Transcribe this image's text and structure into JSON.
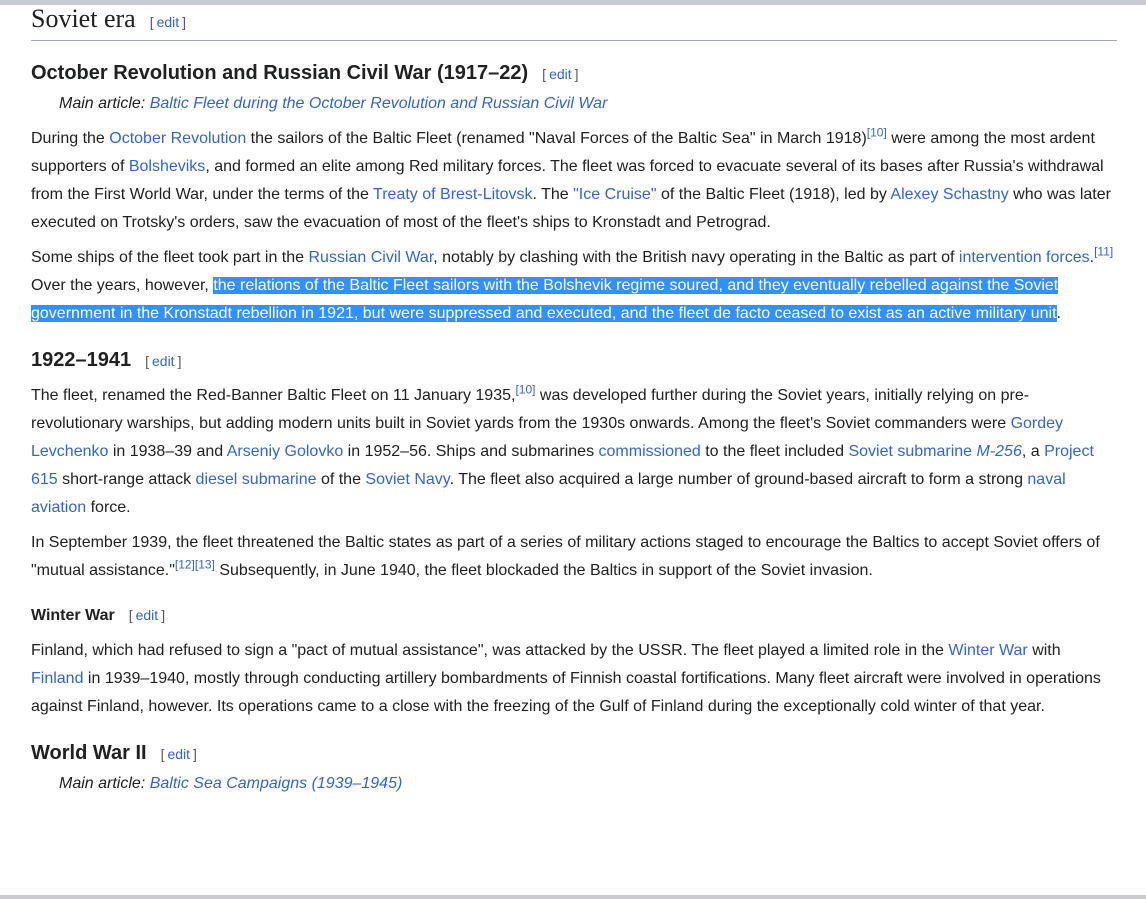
{
  "edit_label": "edit",
  "sections": [
    {
      "kind": "h2",
      "title": "Soviet era"
    },
    {
      "kind": "h3",
      "title": "October Revolution and Russian Civil War (1917–22)"
    },
    {
      "kind": "hat",
      "label": "Main article: ",
      "link": "Baltic Fleet during the October Revolution and Russian Civil War"
    },
    {
      "kind": "p",
      "segs": [
        {
          "t": "During the "
        },
        {
          "t": "October Revolution",
          "link": true
        },
        {
          "t": " the sailors of the Baltic Fleet (renamed \"Naval Forces of the Baltic Sea\" in March 1918)"
        },
        {
          "t": "[10]",
          "sup": true
        },
        {
          "t": " were among the most ardent supporters of "
        },
        {
          "t": "Bolsheviks",
          "link": true
        },
        {
          "t": ", and formed an elite among Red military forces. The fleet was forced to evacuate several of its bases after Russia's withdrawal from the First World War, under the terms of the "
        },
        {
          "t": "Treaty of Brest-Litovsk",
          "link": true
        },
        {
          "t": ". The "
        },
        {
          "t": "\"Ice Cruise\"",
          "link": true
        },
        {
          "t": " of the Baltic Fleet (1918), led by "
        },
        {
          "t": "Alexey Schastny",
          "link": true
        },
        {
          "t": " who was later executed on Trotsky's orders, saw the evacuation of most of the fleet's ships to Kronstadt and Petrograd."
        }
      ]
    },
    {
      "kind": "p",
      "segs": [
        {
          "t": "Some ships of the fleet took part in the "
        },
        {
          "t": "Russian Civil War",
          "link": true
        },
        {
          "t": ", notably by clashing with the British navy operating in the Baltic as part of "
        },
        {
          "t": "intervention forces",
          "link": true
        },
        {
          "t": "."
        },
        {
          "t": "[11]",
          "sup": true
        },
        {
          "t": " Over the years, however, "
        },
        {
          "t": "the relations of the Baltic Fleet sailors with the Bolshevik regime soured, and they eventually rebelled against the Soviet government in the Kronstadt rebellion in 1921, but were suppressed and executed, and the fleet de facto ceased to exist as an active military unit",
          "sel": true
        },
        {
          "t": "."
        }
      ]
    },
    {
      "kind": "h3",
      "title": "1922–1941"
    },
    {
      "kind": "p",
      "segs": [
        {
          "t": "The fleet, renamed the Red-Banner Baltic Fleet on 11 January 1935,"
        },
        {
          "t": "[10]",
          "sup": true
        },
        {
          "t": " was developed further during the Soviet years, initially relying on pre-revolutionary warships, but adding modern units built in Soviet yards from the 1930s onwards. Among the fleet's Soviet commanders were "
        },
        {
          "t": "Gordey Levchenko",
          "link": true
        },
        {
          "t": " in 1938–39 and "
        },
        {
          "t": "Arseniy Golovko",
          "link": true
        },
        {
          "t": " in 1952–56. Ships and submarines "
        },
        {
          "t": "commissioned",
          "link": true
        },
        {
          "t": " to the fleet included "
        },
        {
          "t": "Soviet submarine ",
          "link": true
        },
        {
          "t": "M-256",
          "link": true,
          "italic": true
        },
        {
          "t": ", a "
        },
        {
          "t": "Project 615",
          "link": true
        },
        {
          "t": " short-range attack "
        },
        {
          "t": "diesel submarine",
          "link": true
        },
        {
          "t": " of the "
        },
        {
          "t": "Soviet Navy",
          "link": true
        },
        {
          "t": ". The fleet also acquired a large number of ground-based aircraft to form a strong "
        },
        {
          "t": "naval aviation",
          "link": true
        },
        {
          "t": " force."
        }
      ]
    },
    {
      "kind": "p",
      "segs": [
        {
          "t": "In September 1939, the fleet threatened the Baltic states as part of a series of military actions staged to encourage the Baltics to accept Soviet offers of \"mutual assistance.\""
        },
        {
          "t": "[12]",
          "sup": true
        },
        {
          "t": "[13]",
          "sup": true
        },
        {
          "t": " Subsequently, in June 1940, the fleet blockaded the Baltics in support of the Soviet invasion."
        }
      ]
    },
    {
      "kind": "h4",
      "title": "Winter War"
    },
    {
      "kind": "p",
      "segs": [
        {
          "t": "Finland, which had refused to sign a \"pact of mutual assistance\", was attacked by the USSR. The fleet played a limited role in the "
        },
        {
          "t": "Winter War",
          "link": true
        },
        {
          "t": " with "
        },
        {
          "t": "Finland",
          "link": true
        },
        {
          "t": " in 1939–1940, mostly through conducting artillery bombardments of Finnish coastal fortifications. Many fleet aircraft were involved in operations against Finland, however. Its operations came to a close with the freezing of the Gulf of Finland during the exceptionally cold winter of that year."
        }
      ]
    },
    {
      "kind": "h3",
      "title": "World War II"
    },
    {
      "kind": "hat",
      "label": "Main article: ",
      "link": "Baltic Sea Campaigns (1939–1945)"
    }
  ]
}
